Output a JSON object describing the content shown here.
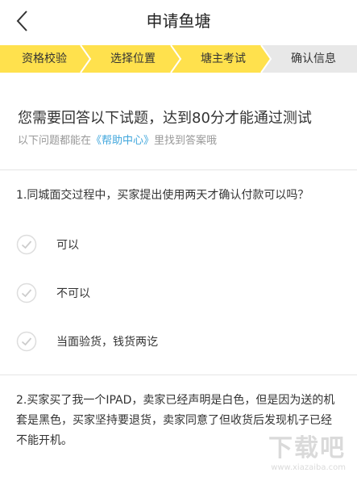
{
  "navbar": {
    "title": "申请鱼塘",
    "back_icon": "chevron-left-icon"
  },
  "steps": [
    {
      "label": "资格校验",
      "state": "done"
    },
    {
      "label": "选择位置",
      "state": "done"
    },
    {
      "label": "塘主考试",
      "state": "active"
    },
    {
      "label": "确认信息",
      "state": "pending"
    }
  ],
  "colors": {
    "step_active": "#FFE14D",
    "step_pending": "#E8E8E8",
    "link": "#3FA6DC"
  },
  "intro": {
    "title": "您需要回答以下试题，达到80分才能通过测试",
    "sub_prefix": "以下问题都能在",
    "sub_link": "《帮助中心》",
    "sub_suffix": "里找到答案哦"
  },
  "questions": [
    {
      "text": "1.同城面交过程中，买家提出使用两天才确认付款可以吗？",
      "options": [
        "可以",
        "不可以",
        "当面验货，钱货两讫"
      ]
    },
    {
      "text": "2.买家买了我一个IPAD，卖家已经声明是白色，但是因为送的机套是黑色，买家坚持要退货，卖家同意了但收货后发现机子已经不能开机。"
    }
  ],
  "watermark": {
    "main": "下载吧",
    "sub": "www.xiazaiba.com"
  }
}
